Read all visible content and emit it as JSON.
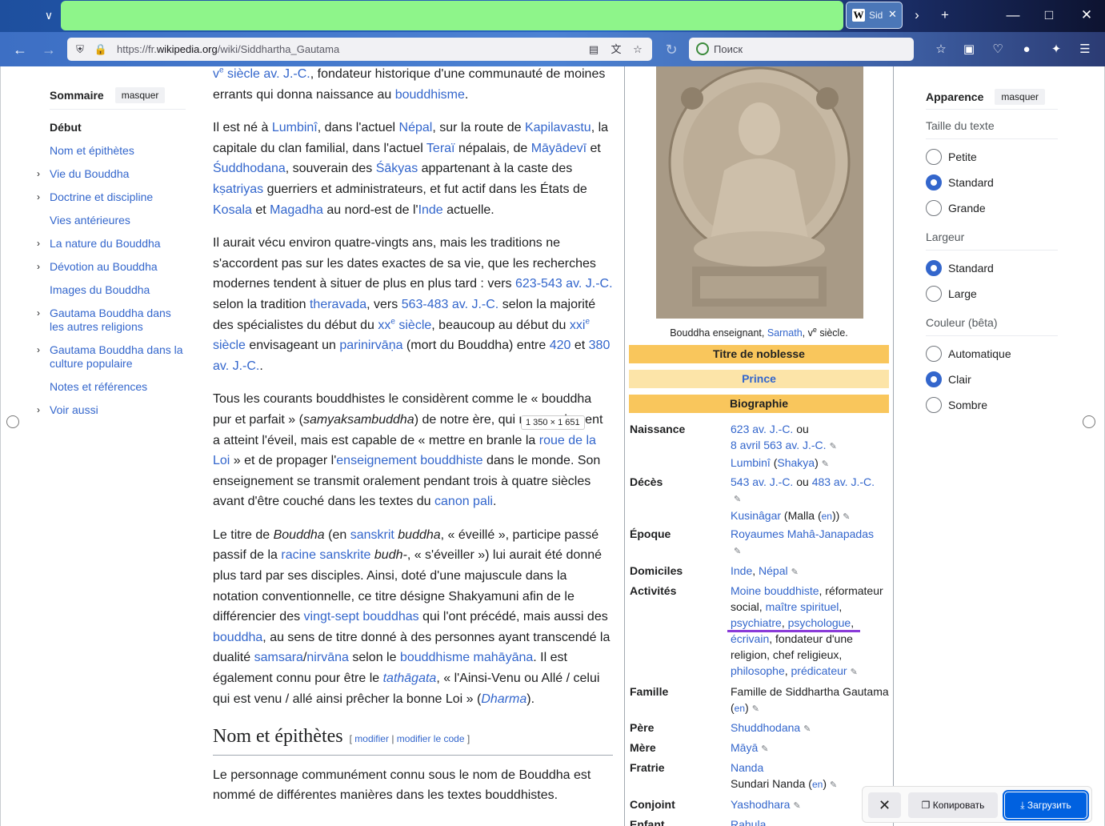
{
  "browser": {
    "tab_title": "Sid",
    "url_prefix": "https://fr.",
    "url_domain": "wikipedia.org",
    "url_path": "/wiki/Siddhartha_Gautama",
    "search_placeholder": "Поиск"
  },
  "toc": {
    "title": "Sommaire",
    "hide": "masquer",
    "start": "Début",
    "items": [
      {
        "label": "Nom et épithètes",
        "chevron": false
      },
      {
        "label": "Vie du Bouddha",
        "chevron": true
      },
      {
        "label": "Doctrine et discipline",
        "chevron": true
      },
      {
        "label": "Vies antérieures",
        "chevron": false
      },
      {
        "label": "La nature du Bouddha",
        "chevron": true
      },
      {
        "label": "Dévotion au Bouddha",
        "chevron": true
      },
      {
        "label": "Images du Bouddha",
        "chevron": false
      },
      {
        "label": "Gautama Bouddha dans les autres religions",
        "chevron": true
      },
      {
        "label": "Gautama Bouddha dans la culture populaire",
        "chevron": true
      },
      {
        "label": "Notes et références",
        "chevron": false
      },
      {
        "label": "Voir aussi",
        "chevron": true
      }
    ]
  },
  "article": {
    "p0": [
      "v",
      "e",
      " siècle av. J.-C.",
      ", fondateur historique d'une communauté de moines errants qui donna naissance au ",
      "bouddhisme",
      "."
    ],
    "p1": [
      "Il est né à ",
      "Lumbinî",
      ", dans l'actuel ",
      "Népal",
      ", sur la route de ",
      "Kapilavastu",
      ", la capitale du clan familial, dans l'actuel ",
      "Teraï",
      " népalais, de ",
      "Māyādevī",
      " et ",
      "Śuddhodana",
      ", souverain des ",
      "Śākyas",
      " appartenant à la caste des ",
      "kṣatriyas",
      " guerriers et administrateurs, et fut actif dans les États de ",
      "Kosala",
      " et ",
      "Magadha",
      " au nord-est de l'",
      "Inde",
      " actuelle."
    ],
    "p2": [
      "Il aurait vécu environ quatre-vingts ans, mais les traditions ne s'accordent pas sur les dates exactes de sa vie, que les recherches modernes tendent à situer de plus en plus tard : vers ",
      "623-543 av. J.-C.",
      " selon la tradition ",
      "theravada",
      ", vers ",
      "563-483 av. J.-C.",
      " selon la majorité des spécialistes du début du ",
      "xx",
      "e",
      " siècle",
      ", beaucoup au début du ",
      "xxi",
      "e",
      " siècle",
      " envisageant un ",
      "parinirvāṇa",
      " (mort du Bouddha) entre ",
      "420",
      " et ",
      "380 av. J.-C.",
      "."
    ],
    "p3": [
      "Tous les courants bouddhistes le considèrent comme le « bouddha pur et parfait » (",
      "samyaksambuddha",
      ") de notre ère, qui non seulement a atteint l'éveil, mais est capable de « mettre en branle la ",
      "roue de la Loi",
      " » et de propager l'",
      "enseignement bouddhiste",
      " dans le monde. Son enseignement se transmit oralement pendant trois à quatre siècles avant d'être couché dans les textes du ",
      "canon pali",
      "."
    ],
    "p4": [
      "Le titre de ",
      "Bouddha",
      " (en ",
      "sanskrit",
      " ",
      "buddha",
      ", « éveillé », participe passé passif de la ",
      "racine sanskrite",
      " ",
      "budh-",
      ", « s'éveiller ») lui aurait été donné plus tard par ses disciples. Ainsi, doté d'une majuscule dans la notation conventionnelle, ce titre désigne Shakyamuni afin de le différencier des ",
      "vingt-sept bouddhas",
      " qui l'ont précédé, mais aussi des ",
      "bouddha",
      ", au sens de titre donné à des personnes ayant transcendé la dualité ",
      "samsara",
      "/",
      "nirvāna",
      " selon le ",
      "bouddhisme mahāyāna",
      ". Il est également connu pour être le ",
      "tathāgata",
      ", « l'Ainsi-Venu ou Allé / celui qui est venu / allé ainsi prêcher la bonne Loi » (",
      "Dharma",
      ")."
    ],
    "h2": "Nom et épithètes",
    "h2_edit": "modifier",
    "h2_edit_code": "modifier le code",
    "p5": "Le personnage communément connu sous le nom de Bouddha est nommé de différentes manières dans les textes bouddhistes."
  },
  "infobox": {
    "caption_pre": "Bouddha enseignant, ",
    "caption_link": "Sarnath",
    "caption_post": ", v",
    "caption_sup": "e",
    "caption_end": " siècle.",
    "band_title": "Titre de noblesse",
    "band_prince": "Prince",
    "band_bio": "Biographie",
    "rows": {
      "naissance": "Naissance",
      "naissance_v1": "623 av. J.-C.",
      "naissance_v1b": " ou",
      "naissance_v2": "8 avril 563 av. J.-C.",
      "naissance_v3": "Lumbinî",
      "naissance_v3b": "Shakya",
      "deces": "Décès",
      "deces_v1": "543 av. J.-C.",
      "deces_v1b": " ou ",
      "deces_v2": "483 av. J.-C.",
      "deces_v3": "Kusinâgar",
      "deces_v3b": " (Malla (",
      "deces_v3c": "en",
      "deces_v3d": "))",
      "epoque": "Époque",
      "epoque_v": "Royaumes Mahâ-Janapadas",
      "domiciles": "Domiciles",
      "domiciles_v1": "Inde",
      "domiciles_v2": "Népal",
      "activites": "Activités",
      "act_1": "Moine bouddhiste",
      "act_2": ", réformateur social, ",
      "act_3": "maître spirituel",
      "act_4": "psychiatre",
      "act_5": "psychologue",
      "act_6": "écrivain",
      "act_7": ", fondateur d'une religion, chef religieux, ",
      "act_8": "philosophe",
      "act_9": "prédicateur",
      "famille": "Famille",
      "famille_v": "Famille de Siddhartha Gautama",
      "famille_en": "en",
      "pere": "Père",
      "pere_v": "Shuddhodana",
      "mere": "Mère",
      "mere_v": "Māyā",
      "fratrie": "Fratrie",
      "fratrie_v1": "Nanda",
      "fratrie_v2": "Sundari Nanda",
      "fratrie_en": "en",
      "conjoint": "Conjoint",
      "conjoint_v": "Yashodhara",
      "enfant": "Enfant",
      "enfant_v": "Rahula"
    }
  },
  "appearance": {
    "title": "Apparence",
    "hide": "masquer",
    "text_size": "Taille du texte",
    "size_opts": [
      {
        "label": "Petite",
        "on": false
      },
      {
        "label": "Standard",
        "on": true
      },
      {
        "label": "Grande",
        "on": false
      }
    ],
    "width": "Largeur",
    "width_opts": [
      {
        "label": "Standard",
        "on": true
      },
      {
        "label": "Large",
        "on": false
      }
    ],
    "color": "Couleur (bêta)",
    "color_opts": [
      {
        "label": "Automatique",
        "on": false
      },
      {
        "label": "Clair",
        "on": true
      },
      {
        "label": "Sombre",
        "on": false
      }
    ]
  },
  "screenshot": {
    "dimensions": "1 350 × 1 651",
    "copy": "Копировать",
    "save": "Загрузить"
  }
}
